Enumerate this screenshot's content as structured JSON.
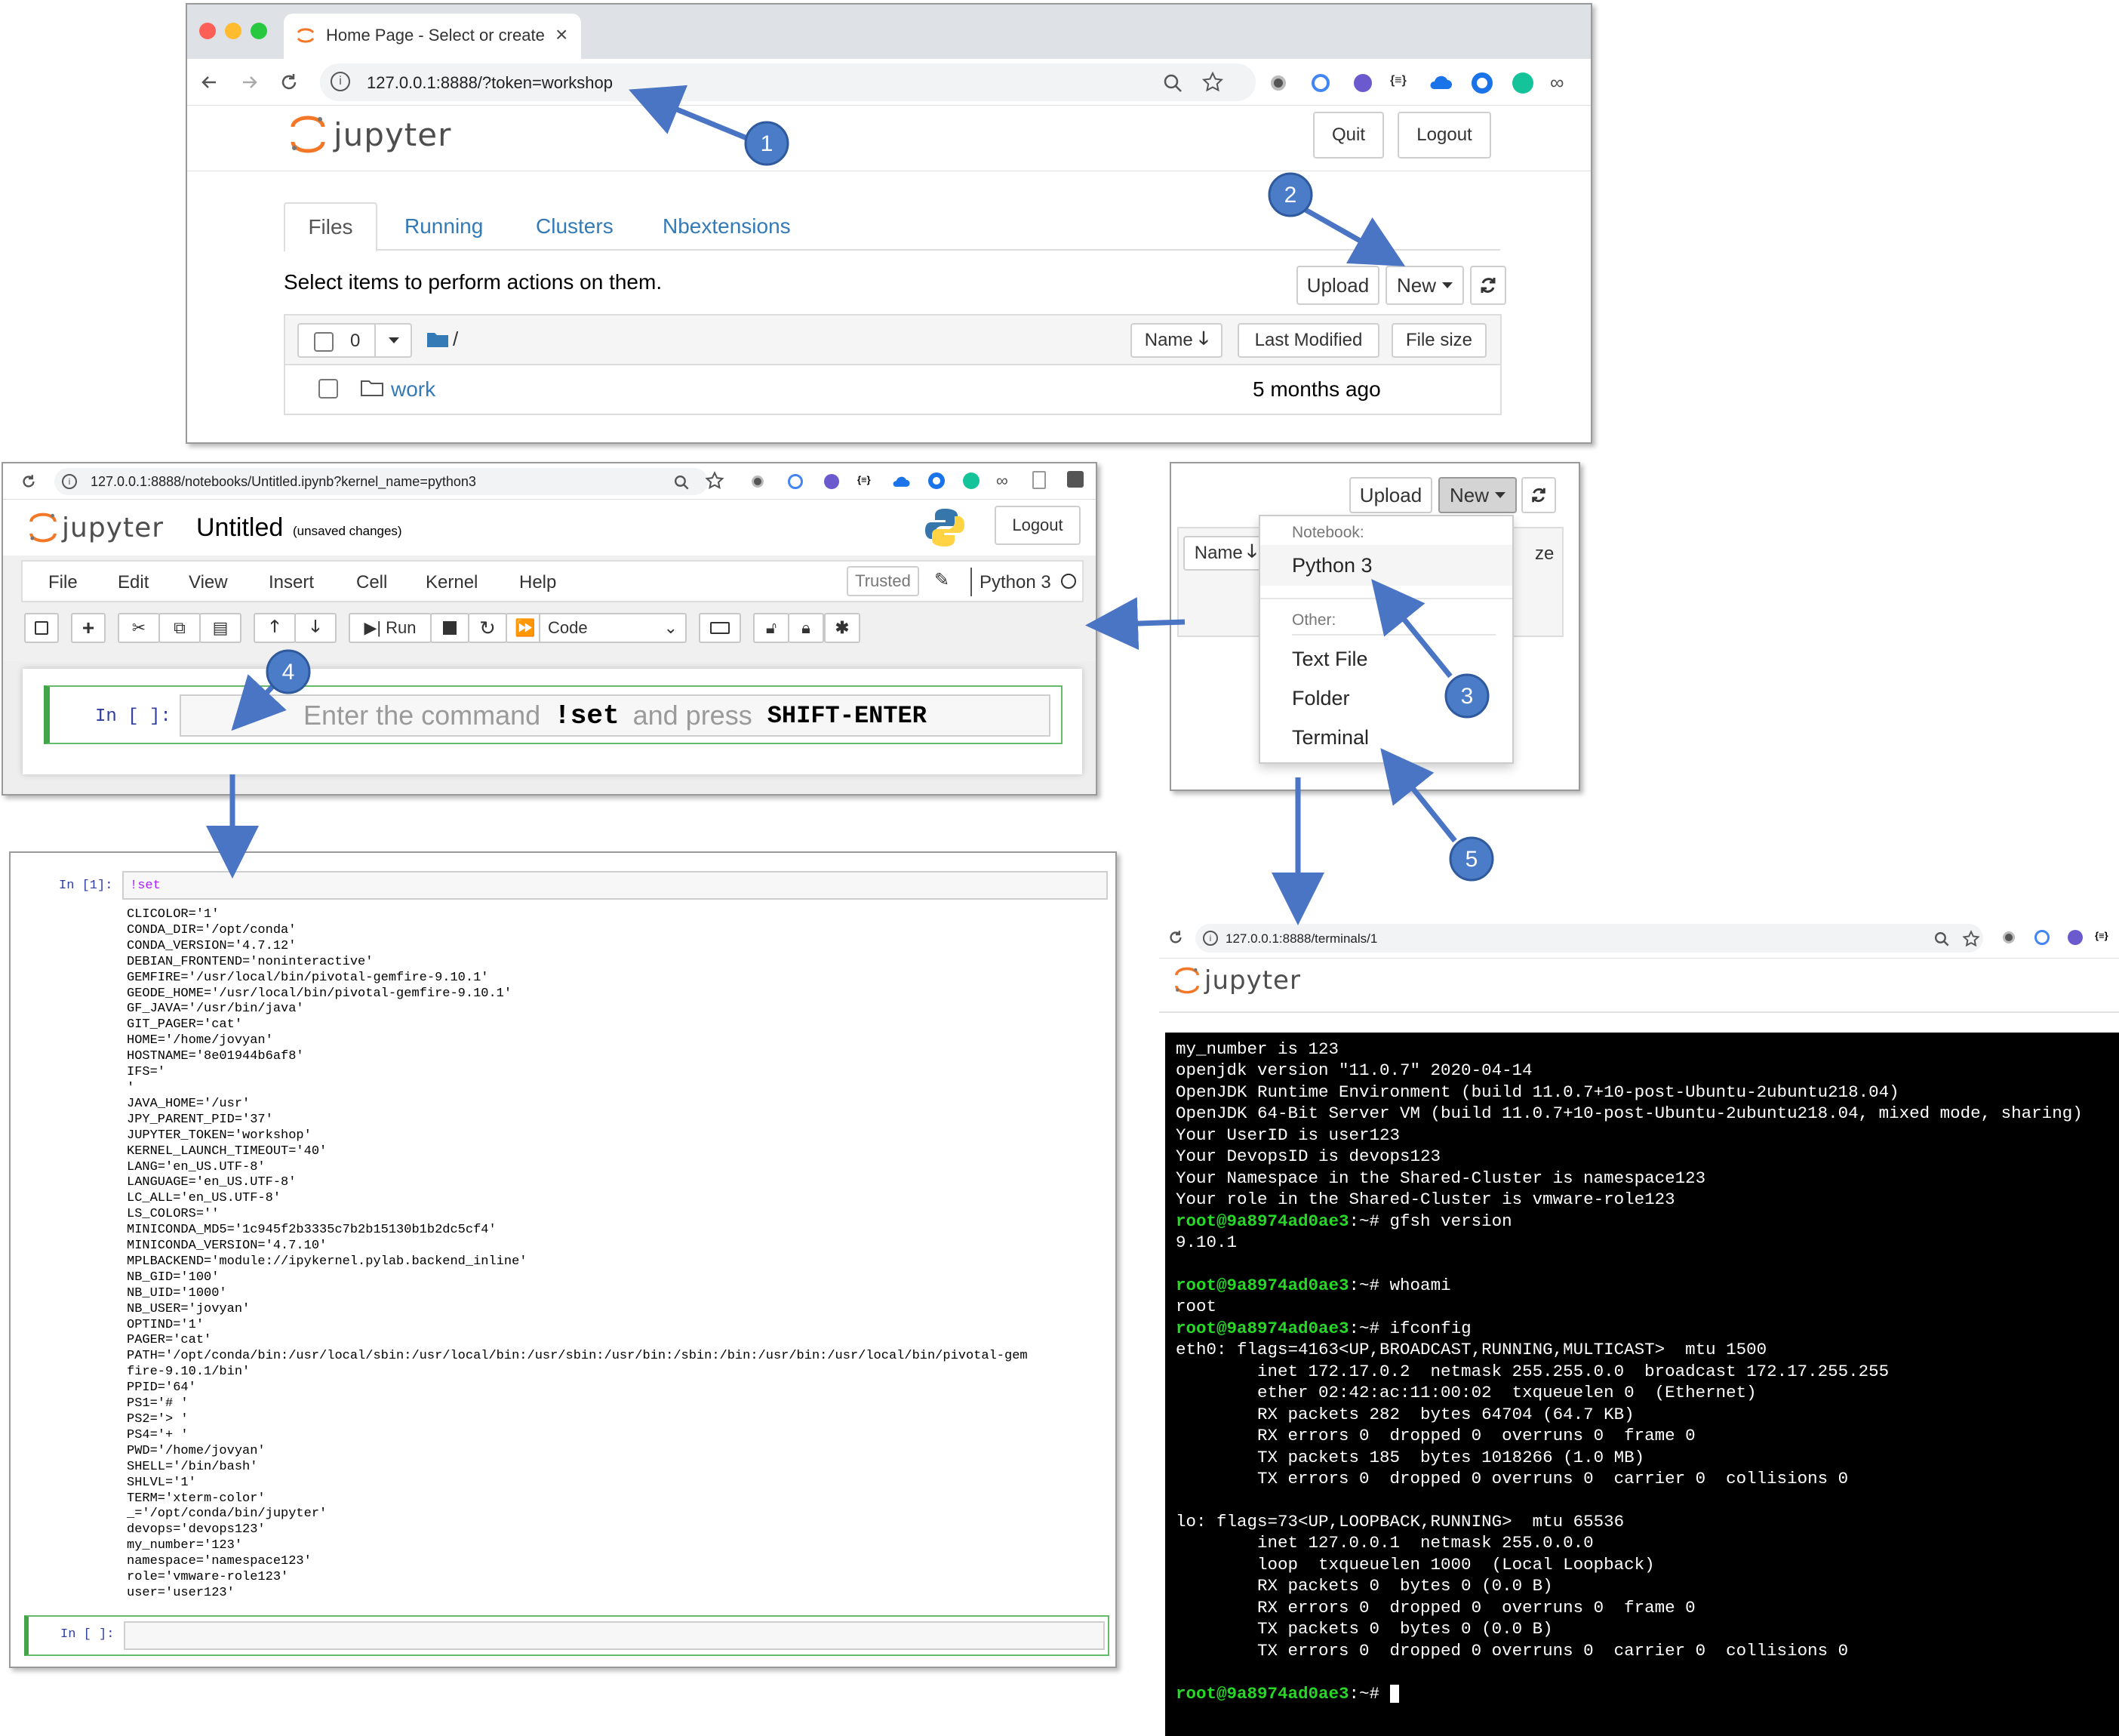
{
  "browser1": {
    "tab_title": "Home Page - Select or create a",
    "tab_close": "×",
    "url": "127.0.0.1:8888/?token=workshop"
  },
  "home": {
    "logo_text": "jupyter",
    "quit_label": "Quit",
    "logout_label": "Logout",
    "tabs": [
      "Files",
      "Running",
      "Clusters",
      "Nbextensions"
    ],
    "select_prompt": "Select items to perform actions on them.",
    "upload_label": "Upload",
    "new_label": "New",
    "selected_count": "0",
    "breadcrumb": "/",
    "col_name": "Name",
    "col_modified": "Last Modified",
    "col_size": "File size",
    "rows": [
      {
        "name": "work",
        "modified": "5 months ago"
      }
    ]
  },
  "notebook": {
    "url": "127.0.0.1:8888/notebooks/Untitled.ipynb?kernel_name=python3",
    "logo_text": "jupyter",
    "title": "Untitled",
    "unsaved": "(unsaved changes)",
    "logout_label": "Logout",
    "menu": [
      "File",
      "Edit",
      "View",
      "Insert",
      "Cell",
      "Kernel",
      "Help"
    ],
    "trusted": "Trusted",
    "kernel": "Python 3",
    "run_label": "Run",
    "cell_type": "Code",
    "prompt": "In [ ]:",
    "hint_a": "Enter the command",
    "hint_cmd": "!set",
    "hint_b": "and press",
    "hint_key": "SHIFT-ENTER"
  },
  "output": {
    "prompt1": "In [1]:",
    "input1": "!set",
    "lines": [
      "CLICOLOR='1'",
      "CONDA_DIR='/opt/conda'",
      "CONDA_VERSION='4.7.12'",
      "DEBIAN_FRONTEND='noninteractive'",
      "GEMFIRE='/usr/local/bin/pivotal-gemfire-9.10.1'",
      "GEODE_HOME='/usr/local/bin/pivotal-gemfire-9.10.1'",
      "GF_JAVA='/usr/bin/java'",
      "GIT_PAGER='cat'",
      "HOME='/home/jovyan'",
      "HOSTNAME='8e01944b6af8'",
      "IFS='",
      "'",
      "JAVA_HOME='/usr'",
      "JPY_PARENT_PID='37'",
      "JUPYTER_TOKEN='workshop'",
      "KERNEL_LAUNCH_TIMEOUT='40'",
      "LANG='en_US.UTF-8'",
      "LANGUAGE='en_US.UTF-8'",
      "LC_ALL='en_US.UTF-8'",
      "LS_COLORS=''",
      "MINICONDA_MD5='1c945f2b3335c7b2b15130b1b2dc5cf4'",
      "MINICONDA_VERSION='4.7.10'",
      "MPLBACKEND='module://ipykernel.pylab.backend_inline'",
      "NB_GID='100'",
      "NB_UID='1000'",
      "NB_USER='jovyan'",
      "OPTIND='1'",
      "PAGER='cat'",
      "PATH='/opt/conda/bin:/usr/local/sbin:/usr/local/bin:/usr/sbin:/usr/bin:/sbin:/bin:/usr/bin:/usr/local/bin/pivotal-gem",
      "fire-9.10.1/bin'",
      "PPID='64'",
      "PS1='# '",
      "PS2='> '",
      "PS4='+ '",
      "PWD='/home/jovyan'",
      "SHELL='/bin/bash'",
      "SHLVL='1'",
      "TERM='xterm-color'",
      "_='/opt/conda/bin/jupyter'",
      "devops='devops123'",
      "my_number='123'",
      "namespace='namespace123'",
      "role='vmware-role123'",
      "user='user123'"
    ],
    "prompt2": "In [ ]:"
  },
  "menu_popup": {
    "upload_label": "Upload",
    "new_label": "New",
    "name_label": "Name",
    "size_fragment": "ze",
    "notebook_header": "Notebook:",
    "python": "Python 3",
    "other_header": "Other:",
    "items": [
      "Text File",
      "Folder",
      "Terminal"
    ]
  },
  "terminal": {
    "url": "127.0.0.1:8888/terminals/1",
    "logo_text": "jupyter",
    "prompt": "root@9a8974ad0ae3",
    "lines": [
      {
        "t": "my_number is 123"
      },
      {
        "t": "openjdk version \"11.0.7\" 2020-04-14"
      },
      {
        "t": "OpenJDK Runtime Environment (build 11.0.7+10-post-Ubuntu-2ubuntu218.04)"
      },
      {
        "t": "OpenJDK 64-Bit Server VM (build 11.0.7+10-post-Ubuntu-2ubuntu218.04, mixed mode, sharing)"
      },
      {
        "t": "Your UserID is user123"
      },
      {
        "t": "Your DevopsID is devops123"
      },
      {
        "t": "Your Namespace in the Shared-Cluster is namespace123"
      },
      {
        "t": "Your role in the Shared-Cluster is vmware-role123"
      },
      {
        "p": "root@9a8974ad0ae3",
        "t": ":~# gfsh version"
      },
      {
        "t": "9.10.1"
      },
      {
        "t": ""
      },
      {
        "p": "root@9a8974ad0ae3",
        "t": ":~# whoami"
      },
      {
        "t": "root"
      },
      {
        "p": "root@9a8974ad0ae3",
        "t": ":~# ifconfig"
      },
      {
        "t": "eth0: flags=4163<UP,BROADCAST,RUNNING,MULTICAST>  mtu 1500"
      },
      {
        "t": "        inet 172.17.0.2  netmask 255.255.0.0  broadcast 172.17.255.255"
      },
      {
        "t": "        ether 02:42:ac:11:00:02  txqueuelen 0  (Ethernet)"
      },
      {
        "t": "        RX packets 282  bytes 64704 (64.7 KB)"
      },
      {
        "t": "        RX errors 0  dropped 0  overruns 0  frame 0"
      },
      {
        "t": "        TX packets 185  bytes 1018266 (1.0 MB)"
      },
      {
        "t": "        TX errors 0  dropped 0 overruns 0  carrier 0  collisions 0"
      },
      {
        "t": ""
      },
      {
        "t": "lo: flags=73<UP,LOOPBACK,RUNNING>  mtu 65536"
      },
      {
        "t": "        inet 127.0.0.1  netmask 255.0.0.0"
      },
      {
        "t": "        loop  txqueuelen 1000  (Local Loopback)"
      },
      {
        "t": "        RX packets 0  bytes 0 (0.0 B)"
      },
      {
        "t": "        RX errors 0  dropped 0  overruns 0  frame 0"
      },
      {
        "t": "        TX packets 0  bytes 0 (0.0 B)"
      },
      {
        "t": "        TX errors 0  dropped 0 overruns 0  carrier 0  collisions 0"
      },
      {
        "t": ""
      },
      {
        "p": "root@9a8974ad0ae3",
        "t": ":~# "
      }
    ]
  },
  "callouts": [
    "1",
    "2",
    "3",
    "4",
    "5"
  ],
  "colors": {
    "callout": "#4a7cc7",
    "arrow": "#4a74c4",
    "link": "#337ab7",
    "prompt": "#27d827",
    "cell_border": "#66bb6a"
  }
}
